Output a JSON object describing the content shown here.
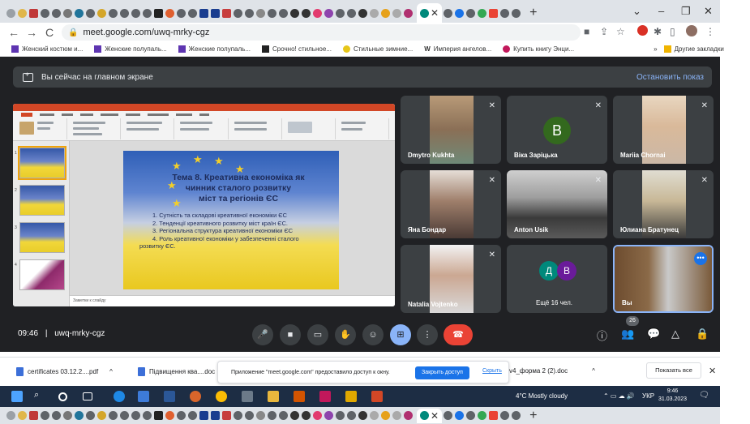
{
  "browser": {
    "url": "meet.google.com/uwq-mrky-cgz",
    "bookmarks": [
      "Женский костюм и...",
      "Женские полупаль...",
      "Женские полупаль...",
      "Срочно! стильное...",
      "Стильные зимние...",
      "Империя ангелов...",
      "Купить книгу Энци..."
    ],
    "other_bookmarks": "Другие закладки",
    "bookmark_more": "»"
  },
  "meet": {
    "banner_text": "Вы сейчас на главном экране",
    "banner_stop": "Остановить показ",
    "time": "09:46",
    "code": "uwq-mrky-cgz",
    "separator": "|",
    "people_count": "26",
    "participants": [
      {
        "name": "Dmytro Kukhta"
      },
      {
        "name": "Віка Заріцька",
        "initial": "B"
      },
      {
        "name": "Mariia Chornai"
      },
      {
        "name": "Яна Бондар"
      },
      {
        "name": "Anton Usik"
      },
      {
        "name": "Юлиана Братунец"
      },
      {
        "name": "Natalia Vojtenko"
      },
      {
        "name": "Ещё 16 чел.",
        "initials": [
          "Д",
          "В"
        ]
      },
      {
        "name": "Вы"
      }
    ]
  },
  "slide": {
    "title_line1": "Тема 8. Креативна економіка як",
    "title_line2": "чинник сталого розвитку",
    "title_line3": "міст та регіонів ЄС",
    "items": [
      "1. Сутність та складові креативної економіки ЄС",
      "2. Тенденції креативного  розвитку  міст країн ЄС.",
      "3. Регіональна структура креативної економіки  ЄС",
      "4. Роль креативної економіки у забезпеченні сталого"
    ],
    "item4_cont": "розвитку ЄС.",
    "notes": "Заметки к слайду"
  },
  "downloads": {
    "items": [
      "certificates 03.12.2....pdf",
      "Підвищення ква....doc",
      "v4_форма 2 (2).doc"
    ],
    "caret": "^",
    "infobar_text": "Приложение \"meet.google.com\" предоставило доступ к окну.",
    "share_button": "Закрыть доступ",
    "hide_link": "Скрыть",
    "show_all": "Показать все",
    "close": "✕"
  },
  "taskbar": {
    "weather": "4°C  Mostly cloudy",
    "lang": "УКР",
    "time": "9:46",
    "date": "31.03.2023"
  },
  "colors": {
    "meet_bg": "#202124",
    "tile_bg": "#3c4043",
    "accent": "#8ab4f8",
    "end_call": "#ea4335"
  },
  "icons": {
    "back": "←",
    "forward": "→",
    "reload": "C",
    "new_tab": "+",
    "minimize": "–",
    "maximize": "❐",
    "close": "✕",
    "dropdown": "⌄",
    "mic_off": "✕",
    "more": "⋮"
  }
}
